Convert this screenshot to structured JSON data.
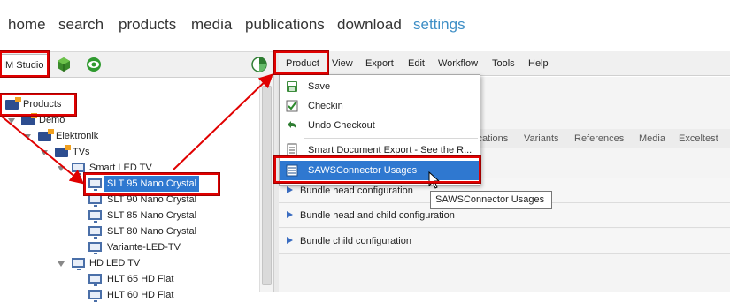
{
  "nav": {
    "items": [
      {
        "label": "home"
      },
      {
        "label": "search"
      },
      {
        "label": "products"
      },
      {
        "label": "media"
      },
      {
        "label": "publications"
      },
      {
        "label": "download"
      },
      {
        "label": "settings"
      }
    ],
    "active_color": "#3f8fc6"
  },
  "left_toolbar": {
    "studio_tab": "IM Studio",
    "icons": [
      "cube-icon",
      "eye-icon",
      "pie-chart-icon"
    ]
  },
  "tree": {
    "products": "Products",
    "demo": "Demo",
    "elektronik": "Elektronik",
    "tvs": "TVs",
    "smart_led": "Smart LED TV",
    "slt95": "SLT 95 Nano Crystal",
    "slt90": "SLT 90 Nano Crystal",
    "slt85": "SLT 85 Nano Crystal",
    "slt80": "SLT 80 Nano Crystal",
    "variante": "Variante-LED-TV",
    "hd_led": "HD LED TV",
    "hlt65": "HLT 65 HD Flat",
    "hlt60": "HLT 60 HD Flat"
  },
  "menubar": {
    "product": "Product",
    "view": "View",
    "export": "Export",
    "edit": "Edit",
    "workflow": "Workflow",
    "tools": "Tools",
    "help": "Help"
  },
  "dropdown": {
    "save": "Save",
    "checkin": "Checkin",
    "undo_checkout": "Undo Checkout",
    "smart_export": "Smart Document Export - See the R...",
    "saws_usages": "SAWSConnector Usages"
  },
  "tabs": {
    "ications": "ications",
    "variants": "Variants",
    "references": "References",
    "media": "Media",
    "exceltest": "Exceltest"
  },
  "sections": {
    "bundle_head": "Bundle head configuration",
    "bundle_head_child": "Bundle head and child configuration",
    "bundle_child": "Bundle child configuration"
  },
  "tooltip": "SAWSConnector Usages",
  "colors": {
    "highlight": "#e00000",
    "selection": "#2f78d0",
    "folder": "#2d4d8f"
  }
}
